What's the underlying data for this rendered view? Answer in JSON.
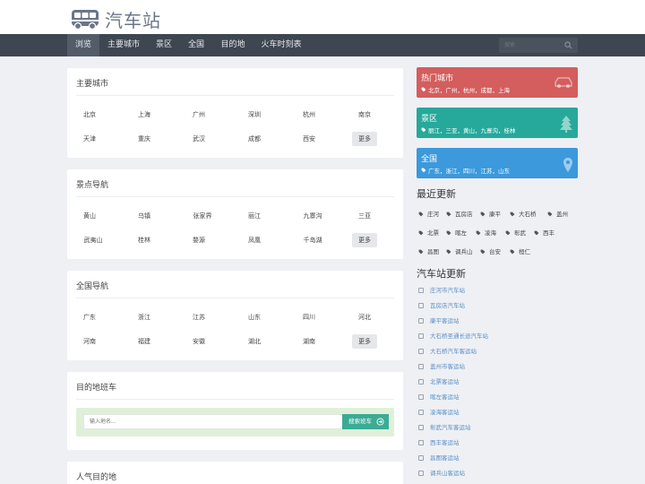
{
  "header": {
    "site_title": "汽车站",
    "logo_icon": "bus-icon"
  },
  "nav": {
    "items": [
      {
        "label": "浏览"
      },
      {
        "label": "主要城市"
      },
      {
        "label": "景区"
      },
      {
        "label": "全国"
      },
      {
        "label": "目的地"
      },
      {
        "label": "火车时刻表"
      }
    ],
    "active_index": 0,
    "search_placeholder": "搜索"
  },
  "panels": {
    "cities": {
      "title": "主要城市",
      "cells": [
        "北京",
        "上海",
        "广州",
        "深圳",
        "杭州",
        "南京",
        "天津",
        "重庆",
        "武汉",
        "成都",
        "西安",
        "更多"
      ]
    },
    "scenic": {
      "title": "景点导航",
      "cells": [
        "黄山",
        "乌镇",
        "张家界",
        "丽江",
        "九寨沟",
        "三亚",
        "武夷山",
        "桂林",
        "婺源",
        "凤凰",
        "千岛湖",
        "更多"
      ]
    },
    "national": {
      "title": "全国导航",
      "cells": [
        "广东",
        "浙江",
        "江苏",
        "山东",
        "四川",
        "河北",
        "河南",
        "福建",
        "安徽",
        "湖北",
        "湖南",
        "更多"
      ]
    },
    "destination": {
      "title": "目的地班车",
      "input_placeholder": "输入地名...",
      "button_label": "搜索班车"
    },
    "popular": {
      "title": "人气目的地"
    }
  },
  "right_cards": [
    {
      "title": "热门城市",
      "list": "北京，广州，杭州，成都，上海",
      "color": "#d45d5d",
      "icon": "car-icon"
    },
    {
      "title": "景区",
      "list": "丽江，三亚，黄山，九寨沟，桂林",
      "color": "#26a89a",
      "icon": "tree-icon"
    },
    {
      "title": "全国",
      "list": "广东，浙江，四川，江苏，山东",
      "color": "#3b99dc",
      "icon": "map-pin-icon"
    }
  ],
  "recent": {
    "title": "最近更新",
    "tags": [
      "庄河",
      "瓦房店",
      "康平",
      "大石桥",
      "盖州",
      "北票",
      "喀左",
      "凌海",
      "彰武",
      "西丰",
      "昌图",
      "调兵山",
      "台安",
      "桓仁"
    ]
  },
  "station_updates": {
    "title": "汽车站更新",
    "items": [
      "庄河市汽车站",
      "瓦房店汽车站",
      "康平客运站",
      "大石桥圣通长途汽车站",
      "大石桥汽车客运站",
      "盖州市客运站",
      "北票客运站",
      "喀左客运站",
      "凌海客运站",
      "彰武汽车客运站",
      "西丰客运站",
      "昌图客运站",
      "调兵山客运站"
    ]
  }
}
